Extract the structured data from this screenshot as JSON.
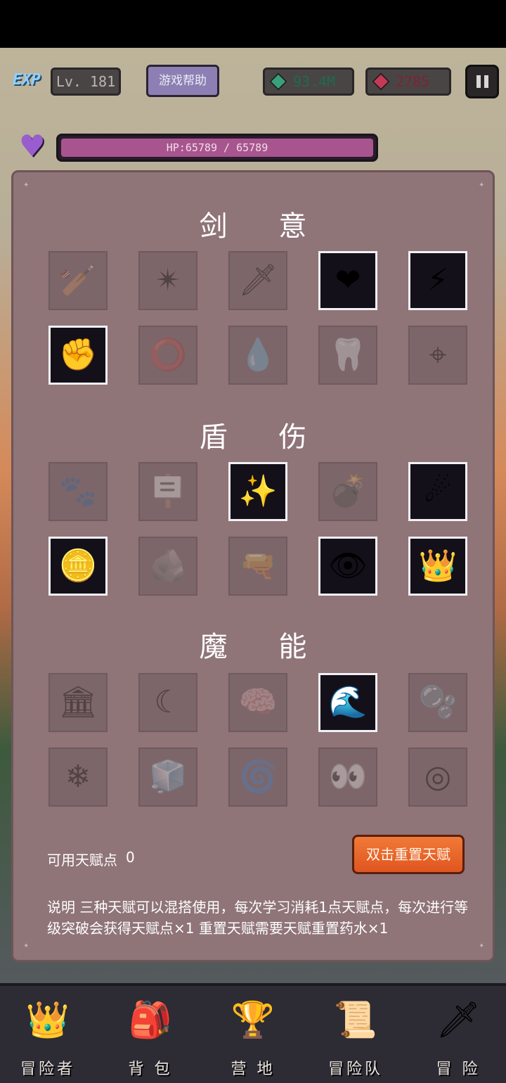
{
  "header": {
    "exp_badge": "EXP",
    "level": "Lv. 181",
    "help_button": "游戏帮助",
    "gold": "93.4M",
    "rubies": "2785"
  },
  "hp": {
    "label": "HP:65789 / 65789",
    "current": 65789,
    "max": 65789
  },
  "talents": {
    "sections": [
      {
        "title": "剑 意",
        "slots": [
          {
            "icon": "club-icon",
            "glyph": "🏏",
            "unlocked": false
          },
          {
            "icon": "starfish-icon",
            "glyph": "✴",
            "unlocked": false
          },
          {
            "icon": "sword-icon",
            "glyph": "🗡",
            "unlocked": false
          },
          {
            "icon": "heart-icon",
            "glyph": "❤",
            "unlocked": true
          },
          {
            "icon": "claw-slash-icon",
            "glyph": "⚡",
            "unlocked": true
          },
          {
            "icon": "fist-icon",
            "glyph": "✊",
            "unlocked": true
          },
          {
            "icon": "blood-ring-icon",
            "glyph": "⭕",
            "unlocked": false
          },
          {
            "icon": "blood-drops-icon",
            "glyph": "💧",
            "unlocked": false
          },
          {
            "icon": "fangs-icon",
            "glyph": "🦷",
            "unlocked": false
          },
          {
            "icon": "crosshair-icon",
            "glyph": "⌖",
            "unlocked": false
          }
        ]
      },
      {
        "title": "盾 伤",
        "slots": [
          {
            "icon": "paw-icon",
            "glyph": "🐾",
            "unlocked": false
          },
          {
            "icon": "sign-post-icon",
            "glyph": "🪧",
            "unlocked": false
          },
          {
            "icon": "star-frame-icon",
            "glyph": "✨",
            "unlocked": true
          },
          {
            "icon": "bomb-icon",
            "glyph": "💣",
            "unlocked": false
          },
          {
            "icon": "meteor-icon",
            "glyph": "☄",
            "unlocked": true
          },
          {
            "icon": "coin-badge-icon",
            "glyph": "🪙",
            "unlocked": true
          },
          {
            "icon": "rocks-icon",
            "glyph": "🪨",
            "unlocked": false
          },
          {
            "icon": "bullet-icon",
            "glyph": "🔫",
            "unlocked": false
          },
          {
            "icon": "eye-icon",
            "glyph": "👁",
            "unlocked": true
          },
          {
            "icon": "crown-burst-icon",
            "glyph": "👑",
            "unlocked": true
          }
        ]
      },
      {
        "title": "魔 能",
        "slots": [
          {
            "icon": "pillars-icon",
            "glyph": "🏛",
            "unlocked": false
          },
          {
            "icon": "crescent-icon",
            "glyph": "☾",
            "unlocked": false
          },
          {
            "icon": "brain-icon",
            "glyph": "🧠",
            "unlocked": false
          },
          {
            "icon": "wave-icon",
            "glyph": "🌊",
            "unlocked": true
          },
          {
            "icon": "bubbles-icon",
            "glyph": "🫧",
            "unlocked": false
          },
          {
            "icon": "ice-shard-icon",
            "glyph": "❄",
            "unlocked": false
          },
          {
            "icon": "ice-spikes-icon",
            "glyph": "🧊",
            "unlocked": false
          },
          {
            "icon": "vortex-icon",
            "glyph": "🌀",
            "unlocked": false
          },
          {
            "icon": "glaring-eyes-icon",
            "glyph": "👀",
            "unlocked": false
          },
          {
            "icon": "rune-disc-icon",
            "glyph": "◎",
            "unlocked": false
          }
        ]
      }
    ],
    "points_label": "可用天赋点",
    "points_value": "0",
    "reset_button": "双击重置天赋",
    "description": "说明 三种天赋可以混搭使用，每次学习消耗1点天赋点，每次进行等级突破会获得天赋点×1 重置天赋需要天赋重置药水×1"
  },
  "nav": {
    "items": [
      {
        "label": "冒险者",
        "icon": "crown-icon",
        "glyph": "👑"
      },
      {
        "label": "背 包",
        "icon": "backpack-icon",
        "glyph": "🎒"
      },
      {
        "label": "营 地",
        "icon": "banner-icon",
        "glyph": "🏆"
      },
      {
        "label": "冒险队",
        "icon": "guild-book-icon",
        "glyph": "📜"
      },
      {
        "label": "冒 险",
        "icon": "sword-icon",
        "glyph": "🗡"
      }
    ]
  },
  "colors": {
    "panel": "#8f7478",
    "locked_slot": "#7d6669",
    "unlocked_border": "#f3f0f4",
    "hp_fill": "#a8558f",
    "reset_button": "#e96a2c"
  }
}
